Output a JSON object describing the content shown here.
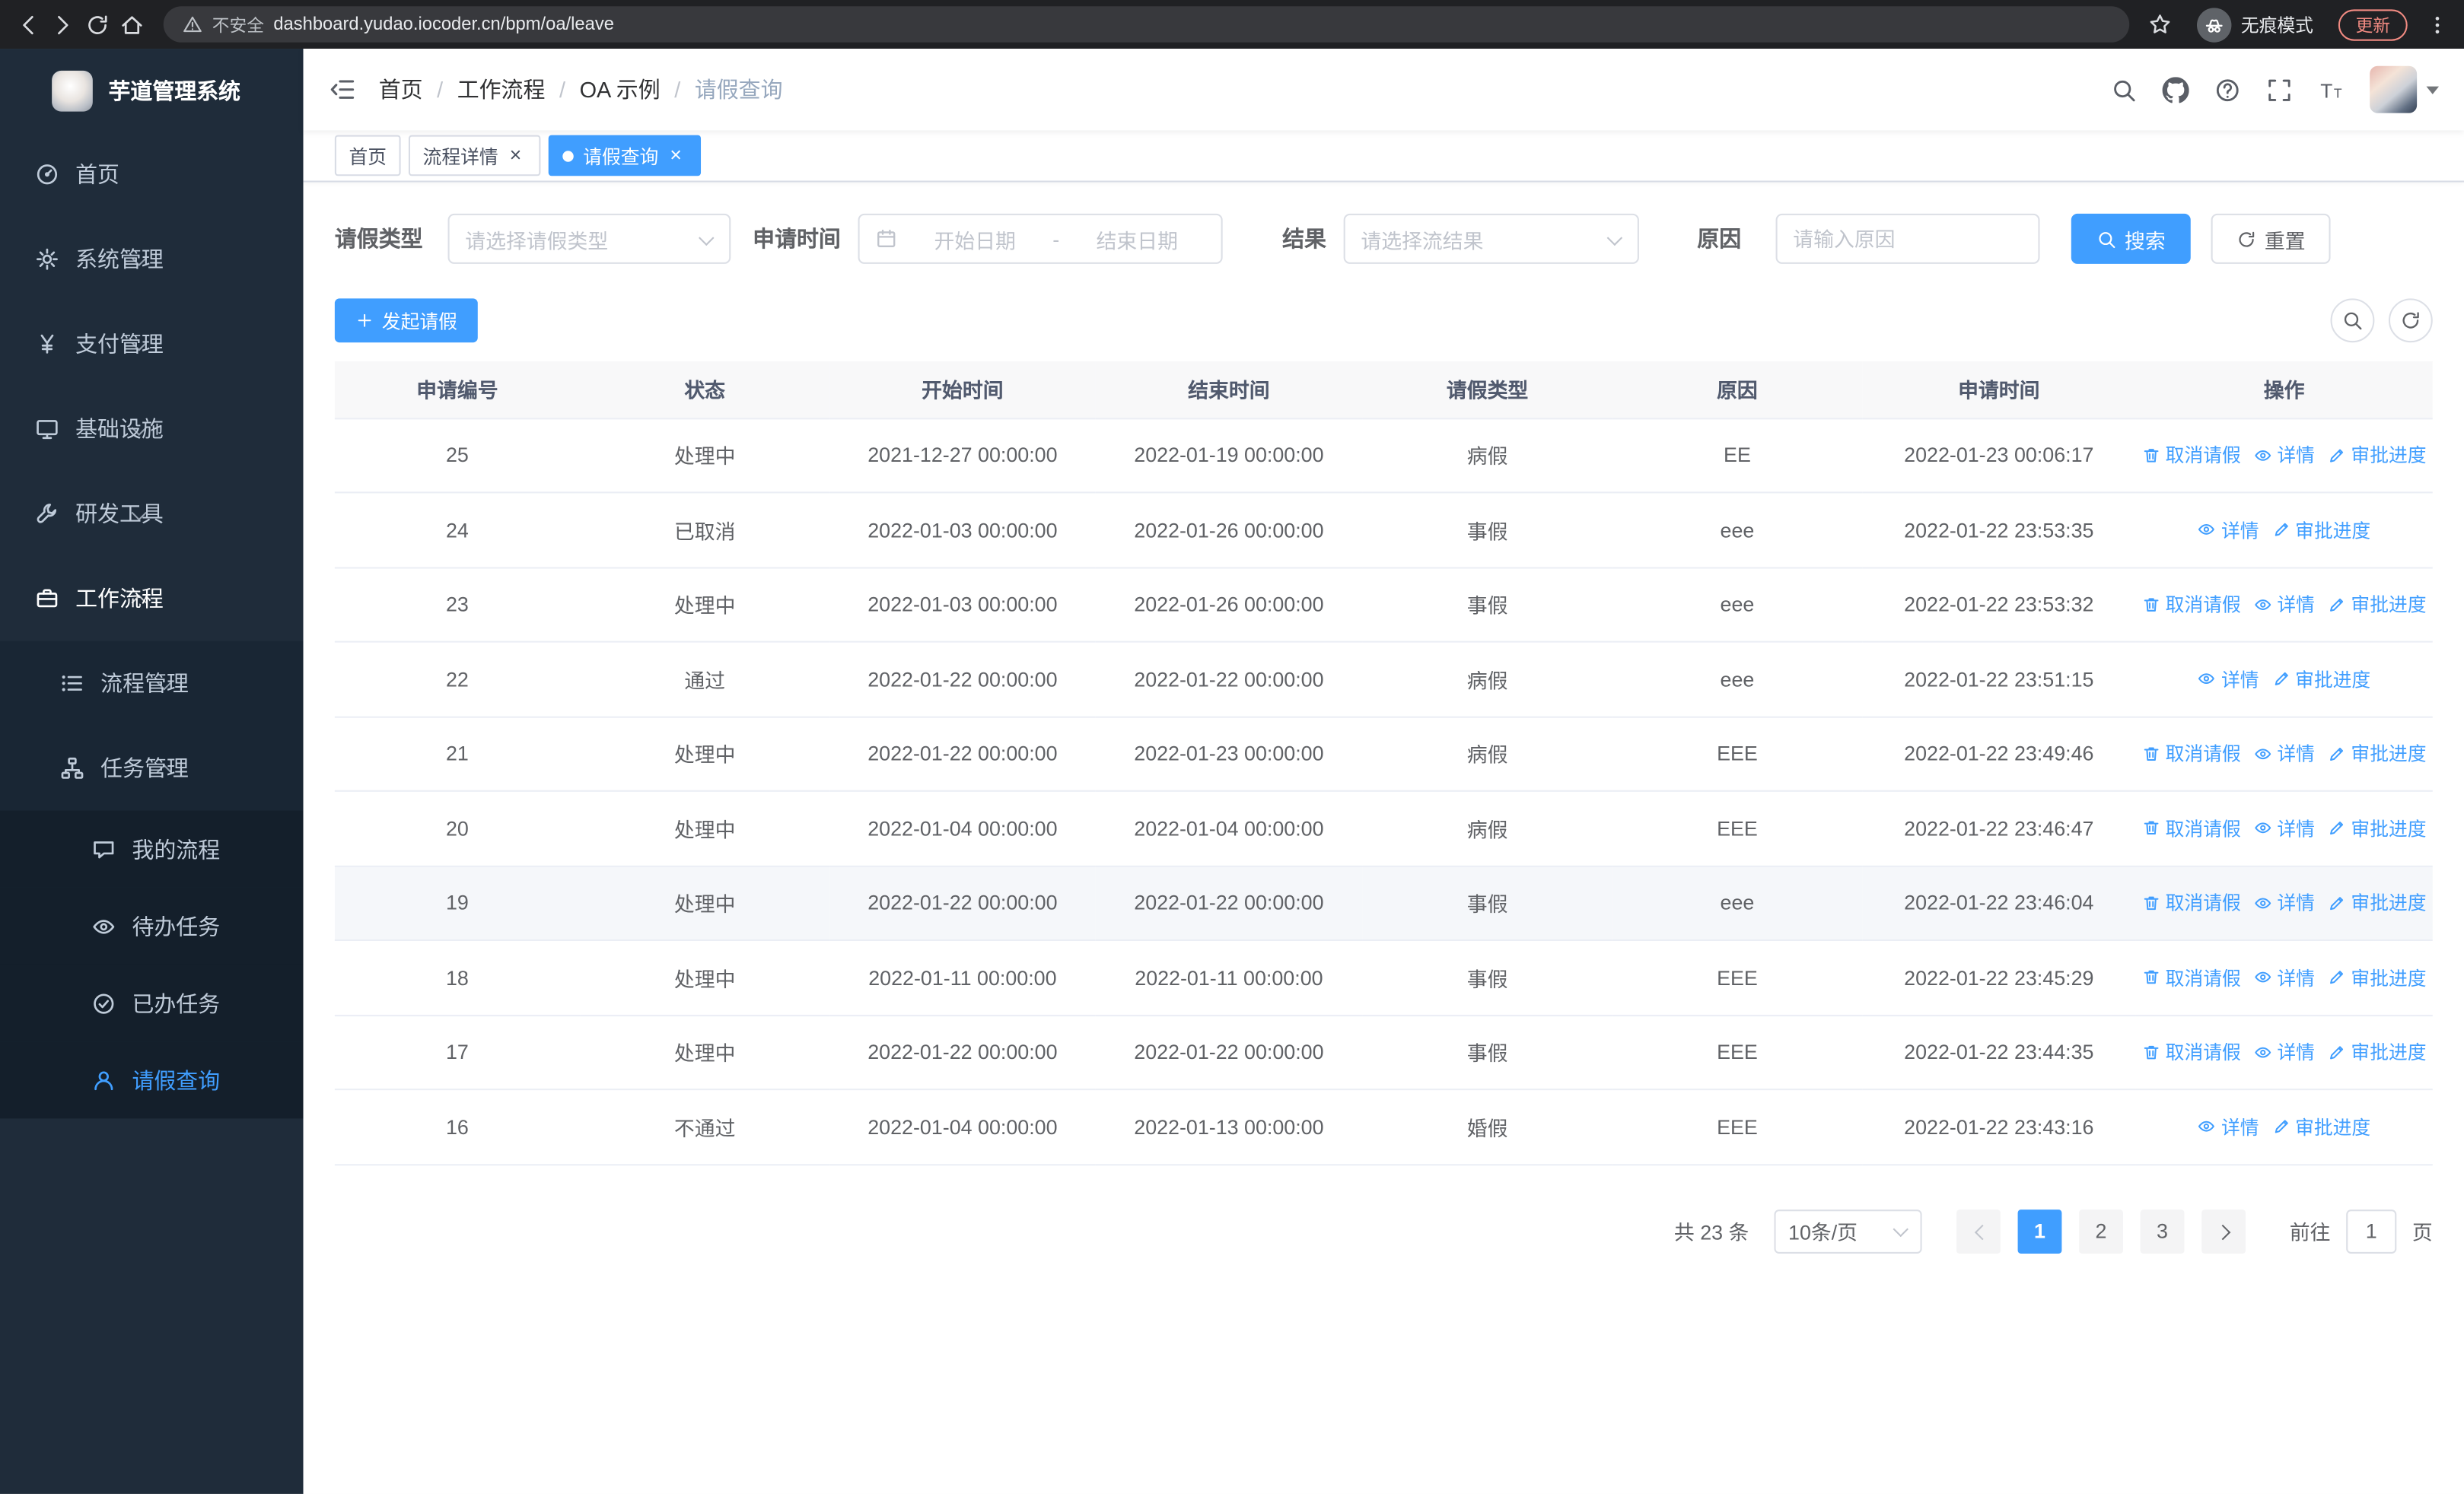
{
  "colors": {
    "primary": "#409eff",
    "sidebar_bg": "#1f2c3a"
  },
  "browser": {
    "security_label": "不安全",
    "url": "dashboard.yudao.iocoder.cn/bpm/oa/leave",
    "incognito_label": "无痕模式",
    "update_label": "更新"
  },
  "sidebar": {
    "logo_title": "芋道管理系统",
    "items": [
      {
        "id": "home",
        "label": "首页",
        "icon": "dashboard-icon",
        "level": 1,
        "expandable": false,
        "expanded": false,
        "active": false,
        "active_trail": false
      },
      {
        "id": "system",
        "label": "系统管理",
        "icon": "gear-icon",
        "level": 1,
        "expandable": true,
        "expanded": false,
        "active": false,
        "active_trail": false
      },
      {
        "id": "payment",
        "label": "支付管理",
        "icon": "yen-icon",
        "level": 1,
        "expandable": true,
        "expanded": false,
        "active": false,
        "active_trail": false
      },
      {
        "id": "infrastructure",
        "label": "基础设施",
        "icon": "monitor-icon",
        "level": 1,
        "expandable": true,
        "expanded": false,
        "active": false,
        "active_trail": false
      },
      {
        "id": "devtools",
        "label": "研发工具",
        "icon": "wrench-icon",
        "level": 1,
        "expandable": true,
        "expanded": false,
        "active": false,
        "active_trail": false
      },
      {
        "id": "workflow",
        "label": "工作流程",
        "icon": "briefcase-icon",
        "level": 1,
        "expandable": true,
        "expanded": true,
        "active": false,
        "active_trail": true
      },
      {
        "id": "process-mgmt",
        "label": "流程管理",
        "icon": "list-icon",
        "level": 2,
        "expandable": true,
        "expanded": false,
        "active": false,
        "active_trail": false
      },
      {
        "id": "task-mgmt",
        "label": "任务管理",
        "icon": "tree-icon",
        "level": 2,
        "expandable": true,
        "expanded": true,
        "active": false,
        "active_trail": false
      },
      {
        "id": "my-process",
        "label": "我的流程",
        "icon": "chat-icon",
        "level": 3,
        "expandable": false,
        "expanded": false,
        "active": false,
        "active_trail": false
      },
      {
        "id": "todo-tasks",
        "label": "待办任务",
        "icon": "eye-icon",
        "level": 3,
        "expandable": false,
        "expanded": false,
        "active": false,
        "active_trail": false
      },
      {
        "id": "done-tasks",
        "label": "已办任务",
        "icon": "check-circle-icon",
        "level": 3,
        "expandable": false,
        "expanded": false,
        "active": false,
        "active_trail": false
      },
      {
        "id": "leave-query",
        "label": "请假查询",
        "icon": "user-icon",
        "level": 3,
        "expandable": false,
        "expanded": false,
        "active": true,
        "active_trail": false
      }
    ]
  },
  "header": {
    "breadcrumb": [
      "首页",
      "工作流程",
      "OA 示例",
      "请假查询"
    ]
  },
  "tabs": [
    {
      "id": "home",
      "label": "首页",
      "closable": false,
      "active": false
    },
    {
      "id": "process-detail",
      "label": "流程详情",
      "closable": true,
      "active": false
    },
    {
      "id": "leave-query",
      "label": "请假查询",
      "closable": true,
      "active": true
    }
  ],
  "filters": {
    "leave_type_label": "请假类型",
    "leave_type_placeholder": "请选择请假类型",
    "apply_time_label": "申请时间",
    "start_date_placeholder": "开始日期",
    "date_separator": "-",
    "end_date_placeholder": "结束日期",
    "result_label": "结果",
    "result_placeholder": "请选择流结果",
    "reason_label": "原因",
    "reason_placeholder": "请输入原因",
    "search_label": "搜索",
    "reset_label": "重置"
  },
  "toolbar": {
    "create_label": "发起请假"
  },
  "table": {
    "columns": [
      "申请编号",
      "状态",
      "开始时间",
      "结束时间",
      "请假类型",
      "原因",
      "申请时间",
      "操作"
    ],
    "action_labels": {
      "cancel": "取消请假",
      "detail": "详情",
      "progress": "审批进度"
    },
    "rows": [
      {
        "id": "25",
        "status": "处理中",
        "start_time": "2021-12-27 00:00:00",
        "end_time": "2022-01-19 00:00:00",
        "leave_type": "病假",
        "reason": "EE",
        "apply_time": "2022-01-23 00:06:17",
        "actions": [
          "cancel",
          "detail",
          "progress"
        ],
        "highlight": false
      },
      {
        "id": "24",
        "status": "已取消",
        "start_time": "2022-01-03 00:00:00",
        "end_time": "2022-01-26 00:00:00",
        "leave_type": "事假",
        "reason": "eee",
        "apply_time": "2022-01-22 23:53:35",
        "actions": [
          "detail",
          "progress"
        ],
        "highlight": false
      },
      {
        "id": "23",
        "status": "处理中",
        "start_time": "2022-01-03 00:00:00",
        "end_time": "2022-01-26 00:00:00",
        "leave_type": "事假",
        "reason": "eee",
        "apply_time": "2022-01-22 23:53:32",
        "actions": [
          "cancel",
          "detail",
          "progress"
        ],
        "highlight": false
      },
      {
        "id": "22",
        "status": "通过",
        "start_time": "2022-01-22 00:00:00",
        "end_time": "2022-01-22 00:00:00",
        "leave_type": "病假",
        "reason": "eee",
        "apply_time": "2022-01-22 23:51:15",
        "actions": [
          "detail",
          "progress"
        ],
        "highlight": false
      },
      {
        "id": "21",
        "status": "处理中",
        "start_time": "2022-01-22 00:00:00",
        "end_time": "2022-01-23 00:00:00",
        "leave_type": "病假",
        "reason": "EEE",
        "apply_time": "2022-01-22 23:49:46",
        "actions": [
          "cancel",
          "detail",
          "progress"
        ],
        "highlight": false
      },
      {
        "id": "20",
        "status": "处理中",
        "start_time": "2022-01-04 00:00:00",
        "end_time": "2022-01-04 00:00:00",
        "leave_type": "病假",
        "reason": "EEE",
        "apply_time": "2022-01-22 23:46:47",
        "actions": [
          "cancel",
          "detail",
          "progress"
        ],
        "highlight": false
      },
      {
        "id": "19",
        "status": "处理中",
        "start_time": "2022-01-22 00:00:00",
        "end_time": "2022-01-22 00:00:00",
        "leave_type": "事假",
        "reason": "eee",
        "apply_time": "2022-01-22 23:46:04",
        "actions": [
          "cancel",
          "detail",
          "progress"
        ],
        "highlight": true
      },
      {
        "id": "18",
        "status": "处理中",
        "start_time": "2022-01-11 00:00:00",
        "end_time": "2022-01-11 00:00:00",
        "leave_type": "事假",
        "reason": "EEE",
        "apply_time": "2022-01-22 23:45:29",
        "actions": [
          "cancel",
          "detail",
          "progress"
        ],
        "highlight": false
      },
      {
        "id": "17",
        "status": "处理中",
        "start_time": "2022-01-22 00:00:00",
        "end_time": "2022-01-22 00:00:00",
        "leave_type": "事假",
        "reason": "EEE",
        "apply_time": "2022-01-22 23:44:35",
        "actions": [
          "cancel",
          "detail",
          "progress"
        ],
        "highlight": false
      },
      {
        "id": "16",
        "status": "不通过",
        "start_time": "2022-01-04 00:00:00",
        "end_time": "2022-01-13 00:00:00",
        "leave_type": "婚假",
        "reason": "EEE",
        "apply_time": "2022-01-22 23:43:16",
        "actions": [
          "detail",
          "progress"
        ],
        "highlight": false
      }
    ]
  },
  "pagination": {
    "total_label": "共 23 条",
    "page_size_value": "10条/页",
    "pages": [
      "1",
      "2",
      "3"
    ],
    "current_page": "1",
    "goto_label": "前往",
    "goto_value": "1",
    "page_unit_label": "页"
  }
}
